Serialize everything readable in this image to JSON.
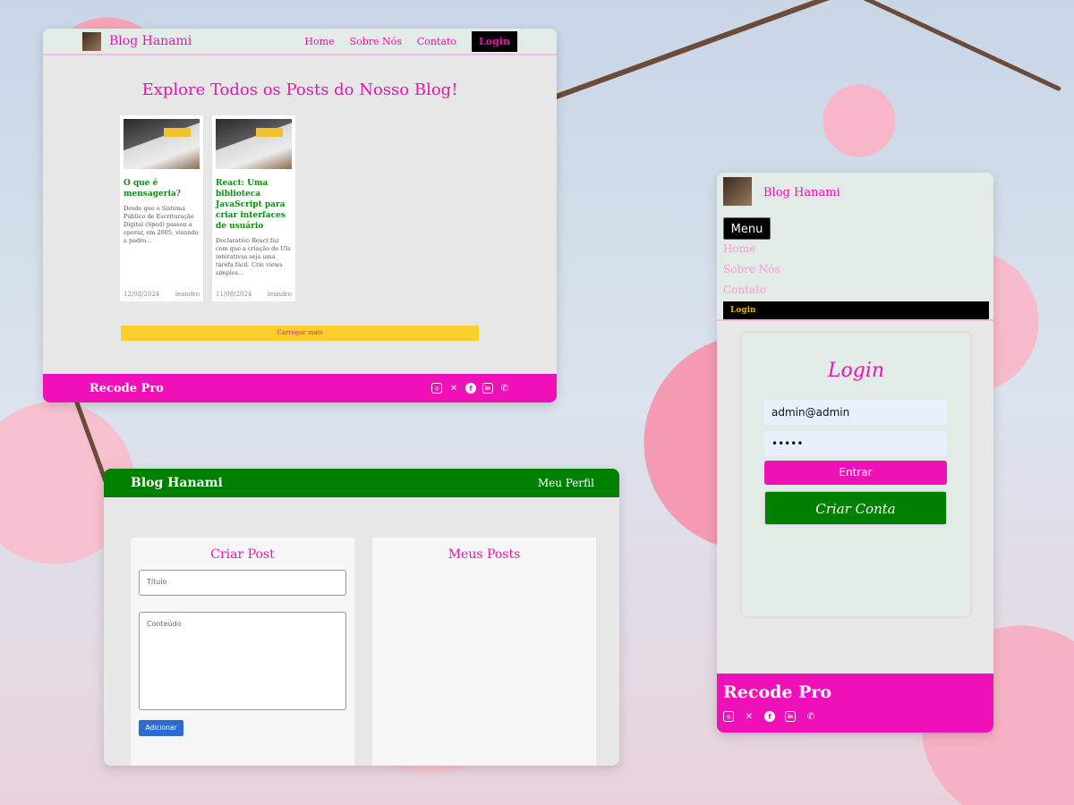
{
  "blog_page": {
    "nav": {
      "brand": "Blog Hanami",
      "links": [
        "Home",
        "Sobre Nós",
        "Contato"
      ],
      "login": "Login"
    },
    "heading": "Explore Todos os Posts do Nosso Blog!",
    "posts": [
      {
        "title": "O que é mensageria?",
        "excerpt": "Desde que o Sistema Público de Escrituração Digital (Sped) passou a operar, em 2005, visando a padro...",
        "date": "12/08/2024",
        "author": "leandro"
      },
      {
        "title": "React: Uma biblioteca JavaScript para criar interfaces de usuário",
        "excerpt": "Declarativo React faz com que a criação de UIs interativas seja uma tarefa fácil. Crie views simples...",
        "date": "11/08/2024",
        "author": "leandro"
      }
    ],
    "load_more": "Carregar mais",
    "footer": {
      "brand": "Recode Pro"
    }
  },
  "profile_page": {
    "nav": {
      "brand": "Blog Hanami",
      "profile": "Meu Perfil"
    },
    "create_post": {
      "heading": "Criar Post",
      "title_placeholder": "Título",
      "content_placeholder": "Conteúdo",
      "add_button": "Adicionar"
    },
    "my_posts": {
      "heading": "Meus Posts"
    }
  },
  "login_page": {
    "nav": {
      "brand": "Blog Hanami",
      "menu_button": "Menu",
      "links": [
        "Home",
        "Sobre Nós",
        "Contato"
      ],
      "login": "Login"
    },
    "form": {
      "heading": "Login",
      "email_value": "admin@admin",
      "password_value": "•••••",
      "submit": "Entrar",
      "create_account": "Criar Conta"
    },
    "footer": {
      "brand": "Recode Pro"
    }
  },
  "social_icons": [
    "instagram-icon",
    "x-icon",
    "facebook-icon",
    "linkedin-icon",
    "whatsapp-icon"
  ],
  "colors": {
    "pink": "#f010b8",
    "green": "#008000",
    "yellow": "#fad02c"
  }
}
